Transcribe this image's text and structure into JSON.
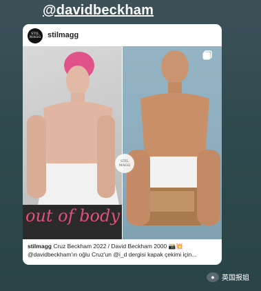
{
  "story": {
    "mention": "@davidbeckham"
  },
  "post": {
    "account": "stilmagg",
    "avatar_text": "STIL MAGG",
    "watermark_text": "STIL MAGG",
    "overlay_text": "out of body",
    "caption_user": "stilmagg",
    "caption_line1": " Cruz Beckham 2022 / David Beckham 2000 📸💥",
    "caption_line2": "@davidbeckham'ın oğlu Cruz'un @i_d dergisi kapak çekimi için..."
  },
  "wechat": {
    "label": "英国报姐",
    "icon": "wechat-icon"
  },
  "colors": {
    "background": "#2f4a4e",
    "overlay_text": "#e3507a",
    "card": "#ffffff"
  }
}
